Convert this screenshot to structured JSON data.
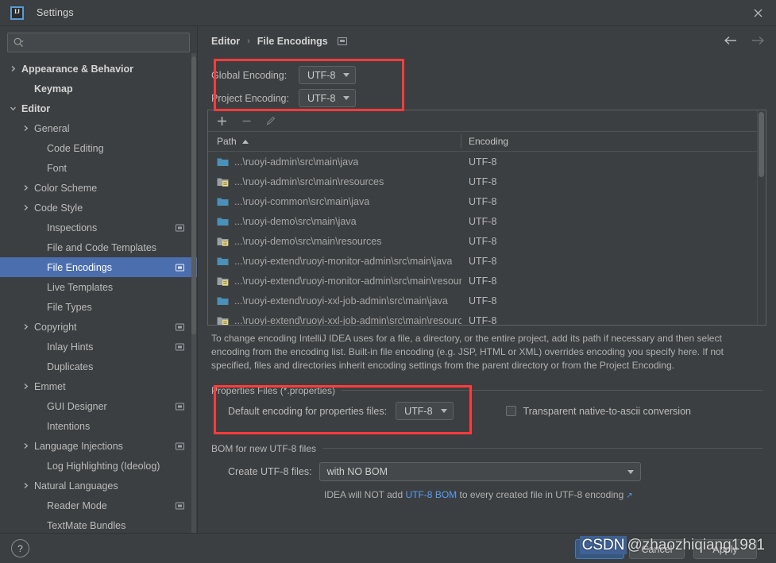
{
  "window": {
    "title": "Settings",
    "logo_icon": "intellij-idea-logo",
    "close_icon": "close-icon"
  },
  "sidebar": {
    "search": {
      "placeholder": "",
      "value": "",
      "icon": "search-icon"
    },
    "items": [
      {
        "label": "Appearance & Behavior",
        "arrow": "collapsed",
        "bold": true,
        "indent": 0,
        "badge": false
      },
      {
        "label": "Keymap",
        "arrow": "none",
        "bold": true,
        "indent": 1,
        "badge": false
      },
      {
        "label": "Editor",
        "arrow": "expanded",
        "bold": true,
        "indent": 0,
        "badge": false
      },
      {
        "label": "General",
        "arrow": "collapsed",
        "bold": false,
        "indent": 1,
        "badge": false
      },
      {
        "label": "Code Editing",
        "arrow": "none",
        "bold": false,
        "indent": 2,
        "badge": false
      },
      {
        "label": "Font",
        "arrow": "none",
        "bold": false,
        "indent": 2,
        "badge": false
      },
      {
        "label": "Color Scheme",
        "arrow": "collapsed",
        "bold": false,
        "indent": 1,
        "badge": false
      },
      {
        "label": "Code Style",
        "arrow": "collapsed",
        "bold": false,
        "indent": 1,
        "badge": false
      },
      {
        "label": "Inspections",
        "arrow": "none",
        "bold": false,
        "indent": 2,
        "badge": true
      },
      {
        "label": "File and Code Templates",
        "arrow": "none",
        "bold": false,
        "indent": 2,
        "badge": false
      },
      {
        "label": "File Encodings",
        "arrow": "none",
        "bold": false,
        "indent": 2,
        "badge": true,
        "selected": true
      },
      {
        "label": "Live Templates",
        "arrow": "none",
        "bold": false,
        "indent": 2,
        "badge": false
      },
      {
        "label": "File Types",
        "arrow": "none",
        "bold": false,
        "indent": 2,
        "badge": false
      },
      {
        "label": "Copyright",
        "arrow": "collapsed",
        "bold": false,
        "indent": 1,
        "badge": true
      },
      {
        "label": "Inlay Hints",
        "arrow": "none",
        "bold": false,
        "indent": 2,
        "badge": true
      },
      {
        "label": "Duplicates",
        "arrow": "none",
        "bold": false,
        "indent": 2,
        "badge": false
      },
      {
        "label": "Emmet",
        "arrow": "collapsed",
        "bold": false,
        "indent": 1,
        "badge": false
      },
      {
        "label": "GUI Designer",
        "arrow": "none",
        "bold": false,
        "indent": 2,
        "badge": true
      },
      {
        "label": "Intentions",
        "arrow": "none",
        "bold": false,
        "indent": 2,
        "badge": false
      },
      {
        "label": "Language Injections",
        "arrow": "collapsed",
        "bold": false,
        "indent": 1,
        "badge": true
      },
      {
        "label": "Log Highlighting (Ideolog)",
        "arrow": "none",
        "bold": false,
        "indent": 2,
        "badge": false
      },
      {
        "label": "Natural Languages",
        "arrow": "collapsed",
        "bold": false,
        "indent": 1,
        "badge": false
      },
      {
        "label": "Reader Mode",
        "arrow": "none",
        "bold": false,
        "indent": 2,
        "badge": true
      },
      {
        "label": "TextMate Bundles",
        "arrow": "none",
        "bold": false,
        "indent": 2,
        "badge": false
      }
    ]
  },
  "main": {
    "breadcrumb": {
      "parent": "Editor",
      "separator": "›",
      "current": "File Encodings"
    },
    "nav": {
      "back_icon": "arrow-left-icon",
      "forward_icon": "arrow-right-icon"
    },
    "global_encoding": {
      "label": "Global Encoding:",
      "value": "UTF-8"
    },
    "project_encoding": {
      "label": "Project Encoding:",
      "value": "UTF-8"
    },
    "toolbar": {
      "add_icon": "plus-icon",
      "remove_icon": "minus-icon",
      "edit_icon": "pencil-icon"
    },
    "table": {
      "columns": [
        "Path",
        "Encoding"
      ],
      "sort_column": "Path",
      "sort_direction": "asc",
      "rows": [
        {
          "icon": "folder-java-icon",
          "path": "...\\ruoyi-admin\\src\\main\\java",
          "encoding": "UTF-8"
        },
        {
          "icon": "folder-resources-icon",
          "path": "...\\ruoyi-admin\\src\\main\\resources",
          "encoding": "UTF-8"
        },
        {
          "icon": "folder-java-icon",
          "path": "...\\ruoyi-common\\src\\main\\java",
          "encoding": "UTF-8"
        },
        {
          "icon": "folder-java-icon",
          "path": "...\\ruoyi-demo\\src\\main\\java",
          "encoding": "UTF-8"
        },
        {
          "icon": "folder-resources-icon",
          "path": "...\\ruoyi-demo\\src\\main\\resources",
          "encoding": "UTF-8"
        },
        {
          "icon": "folder-java-icon",
          "path": "...\\ruoyi-extend\\ruoyi-monitor-admin\\src\\main\\java",
          "encoding": "UTF-8"
        },
        {
          "icon": "folder-resources-icon",
          "path": "...\\ruoyi-extend\\ruoyi-monitor-admin\\src\\main\\resources",
          "encoding": "UTF-8"
        },
        {
          "icon": "folder-java-icon",
          "path": "...\\ruoyi-extend\\ruoyi-xxl-job-admin\\src\\main\\java",
          "encoding": "UTF-8"
        },
        {
          "icon": "folder-resources-icon",
          "path": "...\\ruoyi-extend\\ruoyi-xxl-job-admin\\src\\main\\resources",
          "encoding": "UTF-8"
        }
      ]
    },
    "description": "To change encoding IntelliJ IDEA uses for a file, a directory, or the entire project, add its path if necessary and then select encoding from the encoding list. Built-in file encoding (e.g. JSP, HTML or XML) overrides encoding you specify here. If not specified, files and directories inherit encoding settings from the parent directory or from the Project Encoding.",
    "properties_group": {
      "title": "Properties Files (*.properties)",
      "default_encoding_label": "Default encoding for properties files:",
      "default_encoding_value": "UTF-8",
      "transparent_checkbox_label": "Transparent native-to-ascii conversion",
      "transparent_checked": false
    },
    "bom_group": {
      "title": "BOM for new UTF-8 files",
      "create_label": "Create UTF-8 files:",
      "create_value": "with NO BOM",
      "hint_prefix": "IDEA will NOT add ",
      "hint_link": "UTF-8 BOM",
      "hint_suffix": " to every created file in UTF-8 encoding",
      "hint_external_icon": "external-link-icon"
    }
  },
  "footer": {
    "help_label": "?",
    "ok_label": "OK",
    "cancel_label": "Cancel",
    "apply_label": "Apply"
  },
  "watermark": {
    "badge": "CSDN",
    "text": "@zhaozhiqiang1981"
  },
  "colors": {
    "accent_selection": "#4b6eaf",
    "annotation": "#ff3b3b",
    "link": "#589df6",
    "background": "#3c3f41",
    "primary_button": "#365880"
  }
}
